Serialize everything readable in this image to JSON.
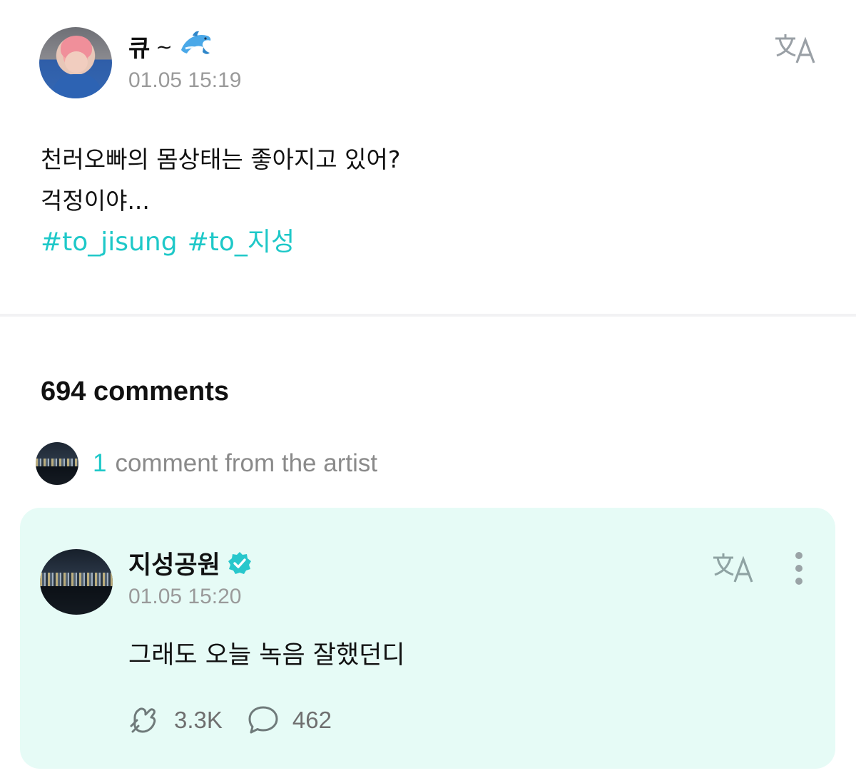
{
  "post": {
    "author_name": "큐",
    "author_suffix": "~",
    "author_emoji_icon": "dolphin-icon",
    "timestamp": "01.05 15:19",
    "lines": [
      "천러오빠의 몸상태는 좋아지고 있어?",
      "걱정이야..."
    ],
    "hashtags": [
      "#to_jisung",
      "#to_지성"
    ]
  },
  "comments": {
    "count_label": "694 comments",
    "artist_count": "1",
    "artist_label": "comment from the artist"
  },
  "artist_comment": {
    "name": "지성공원",
    "verified_icon": "verified-badge-icon",
    "timestamp": "01.05 15:20",
    "text": "그래도 오늘 녹음 잘했던디",
    "likes": "3.3K",
    "replies": "462"
  },
  "colors": {
    "accent": "#1ec8c8",
    "card_bg": "#e6fbf6",
    "muted": "#9a9a9a"
  }
}
